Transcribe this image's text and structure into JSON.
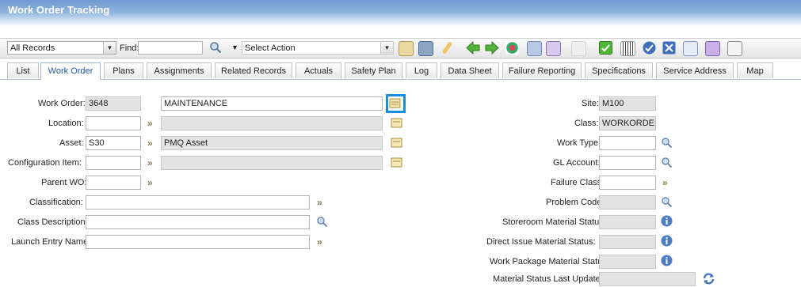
{
  "app": {
    "title": "Work Order Tracking"
  },
  "toolbar": {
    "record_filter": "All Records",
    "find_label": "Find:",
    "find_value": "",
    "action_select": "Select Action"
  },
  "tabs": [
    {
      "label": "List"
    },
    {
      "label": "Work Order"
    },
    {
      "label": "Plans"
    },
    {
      "label": "Assignments"
    },
    {
      "label": "Related Records"
    },
    {
      "label": "Actuals"
    },
    {
      "label": "Safety Plan"
    },
    {
      "label": "Log"
    },
    {
      "label": "Data Sheet"
    },
    {
      "label": "Failure Reporting"
    },
    {
      "label": "Specifications"
    },
    {
      "label": "Service Address"
    },
    {
      "label": "Map"
    }
  ],
  "form": {
    "work_order_label": "Work Order:",
    "work_order": "3648",
    "description": "MAINTENANCE",
    "location_label": "Location:",
    "location": "",
    "location_desc": "",
    "asset_label": "Asset:",
    "asset": "S30",
    "asset_desc": "PMQ Asset",
    "config_label": "Configuration Item:",
    "config": "",
    "config_desc": "",
    "parent_label": "Parent WO:",
    "parent": "",
    "classification_label": "Classification:",
    "classification": "",
    "class_desc_label": "Class Description:",
    "class_desc": "",
    "launch_label": "Launch Entry Name:",
    "launch": "",
    "site_label": "Site:",
    "site": "M100",
    "class_label": "Class:",
    "class": "WORKORDER",
    "work_type_label": "Work Type:",
    "work_type": "",
    "gl_label": "GL Account:",
    "gl": "",
    "failure_label": "Failure Class:",
    "failure": "",
    "problem_label": "Problem Code:",
    "problem": "",
    "storeroom_label": "Storeroom Material Status:",
    "storeroom": "",
    "direct_label": "Direct Issue Material Status:",
    "direct": "",
    "package_label": "Work Package Material Status:",
    "package": "",
    "updated_label": "Material Status Last Updated:",
    "updated": ""
  },
  "colors": {
    "accent": "#1e5aa8",
    "highlight": "#1a8fe0",
    "title_bar": "#6f9ad0"
  },
  "icons": [
    "search-icon",
    "dropdown-icon",
    "detail-menu-icon",
    "go-to-icon",
    "info-icon",
    "refresh-icon",
    "save-icon",
    "prev-icon",
    "next-icon"
  ]
}
